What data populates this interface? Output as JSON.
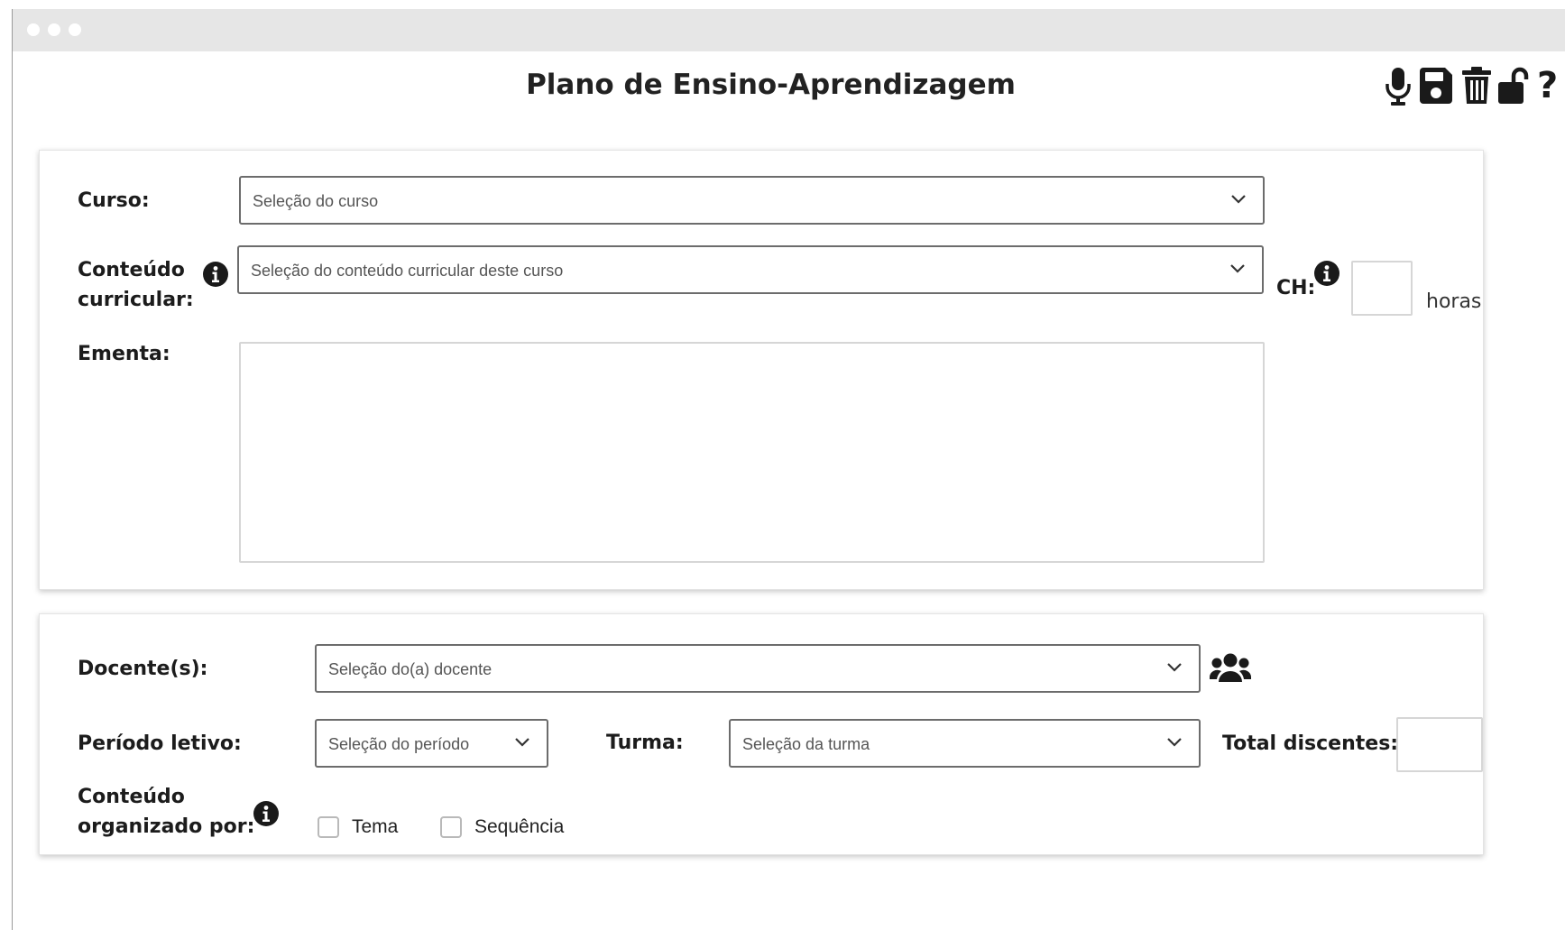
{
  "page": {
    "title": "Plano de Ensino-Aprendizagem"
  },
  "toolbar": {
    "icons": [
      "microphone-icon",
      "save-icon",
      "trash-icon",
      "unlock-icon",
      "help-icon"
    ],
    "help_glyph": "?"
  },
  "section1": {
    "curso": {
      "label": "Curso:",
      "placeholder": "Seleção do curso"
    },
    "conteudo": {
      "label_line1": "Conteúdo",
      "label_line2": "curricular:",
      "placeholder": "Seleção do conteúdo curricular deste curso"
    },
    "ch": {
      "label": "CH:",
      "value": "",
      "unit": "horas"
    },
    "ementa": {
      "label": "Ementa:",
      "value": ""
    }
  },
  "section2": {
    "docente": {
      "label": "Docente(s):",
      "placeholder": "Seleção do(a) docente"
    },
    "periodo": {
      "label": "Período letivo:",
      "placeholder": "Seleção do período"
    },
    "turma": {
      "label": "Turma:",
      "placeholder": "Seleção da turma"
    },
    "total_discentes": {
      "label": "Total discentes:",
      "value": ""
    },
    "organizado": {
      "label_line1": "Conteúdo",
      "label_line2": "organizado por:",
      "options": [
        {
          "label": "Tema",
          "checked": false
        },
        {
          "label": "Sequência",
          "checked": false
        }
      ]
    }
  },
  "colors": {
    "titlebar": "#e6e6e6",
    "icon": "#1a1a1a",
    "select_border": "#6c6c6c"
  }
}
